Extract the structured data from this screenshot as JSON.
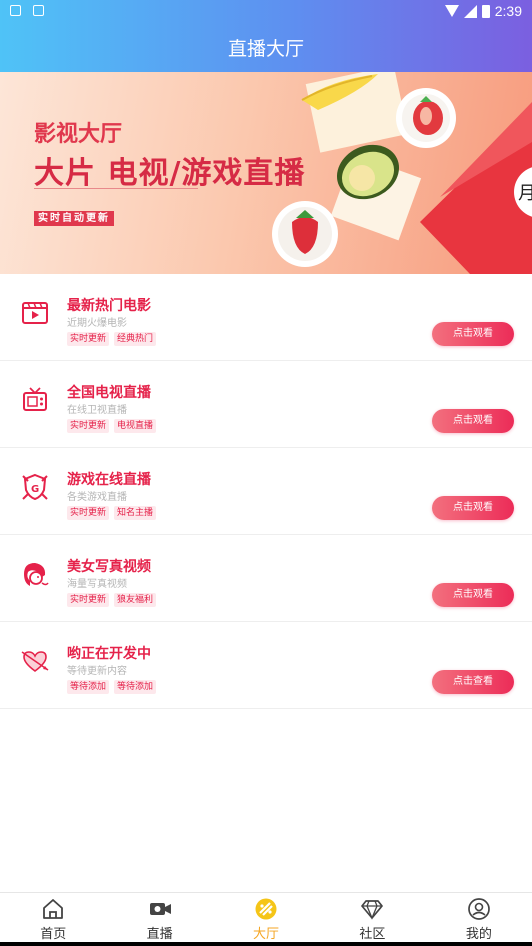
{
  "status": {
    "time": "2:39"
  },
  "header": {
    "title": "直播大厅"
  },
  "banner": {
    "subtitle": "影视大厅",
    "headline": "大片 电视/游戏直播",
    "tag": "实时自动更新"
  },
  "items": [
    {
      "title": "最新热门电影",
      "desc": "近期火爆电影",
      "tags": [
        "实时更新",
        "经典热门"
      ],
      "button": "点击观看",
      "icon": "film-icon"
    },
    {
      "title": "全国电视直播",
      "desc": "在线卫视直播",
      "tags": [
        "实时更新",
        "电视直播"
      ],
      "button": "点击观看",
      "icon": "tv-icon"
    },
    {
      "title": "游戏在线直播",
      "desc": "各类游戏直播",
      "tags": [
        "实时更新",
        "知名主播"
      ],
      "button": "点击观看",
      "icon": "game-shield-icon"
    },
    {
      "title": "美女写真视频",
      "desc": "海量写真视频",
      "tags": [
        "实时更新",
        "狼友福利"
      ],
      "button": "点击观看",
      "icon": "woman-icon"
    },
    {
      "title": "哟正在开发中",
      "desc": "等待更新内容",
      "tags": [
        "等待添加",
        "等待添加"
      ],
      "button": "点击查看",
      "icon": "heart-arrow-icon"
    }
  ],
  "tabs": [
    {
      "label": "首页",
      "icon": "home-icon"
    },
    {
      "label": "直播",
      "icon": "video-camera-icon"
    },
    {
      "label": "大厅",
      "icon": "hall-icon",
      "active": true
    },
    {
      "label": "社区",
      "icon": "diamond-icon"
    },
    {
      "label": "我的",
      "icon": "profile-icon"
    }
  ],
  "colors": {
    "accent": "#e5224a",
    "tab_active": "#f5a623"
  }
}
